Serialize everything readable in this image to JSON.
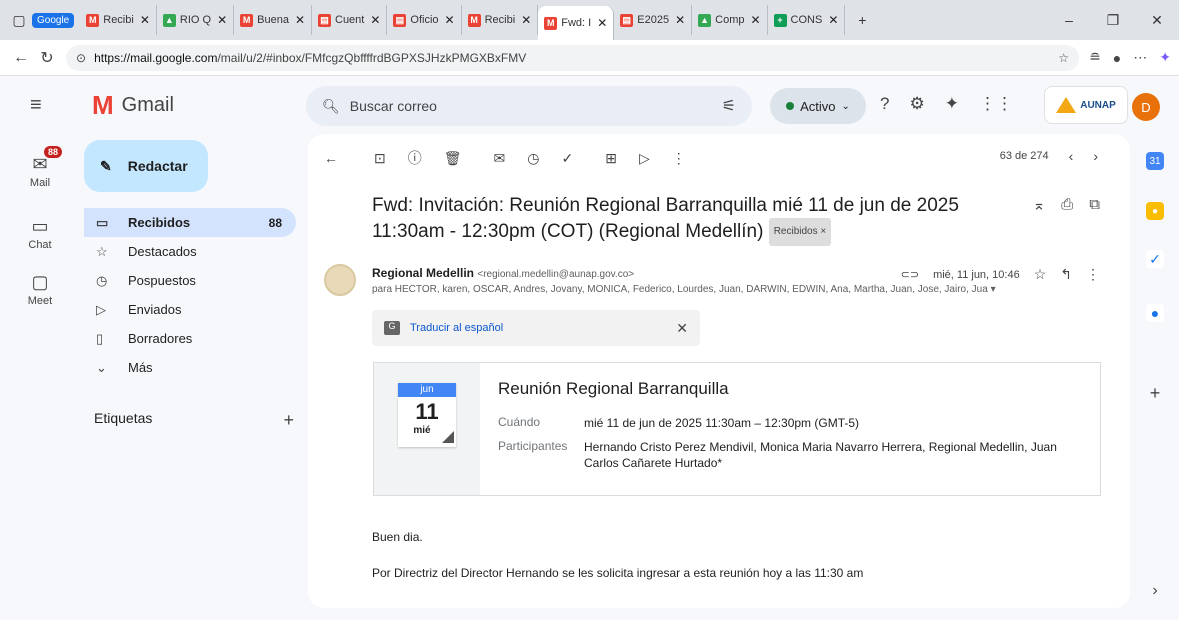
{
  "browser": {
    "google_chip": "Google",
    "tabs": [
      {
        "label": "Recibi",
        "fav": "M",
        "color": "#ea4335"
      },
      {
        "label": "RIO Q",
        "fav": "▲",
        "color": "#34a853"
      },
      {
        "label": "Buena",
        "fav": "M",
        "color": "#ea4335"
      },
      {
        "label": "Cuent",
        "fav": "▤",
        "color": "#ea4335"
      },
      {
        "label": "Oficio",
        "fav": "▤",
        "color": "#ea4335"
      },
      {
        "label": "Recibi",
        "fav": "M",
        "color": "#ea4335"
      },
      {
        "label": "Fwd: I",
        "fav": "M",
        "color": "#ea4335"
      },
      {
        "label": "E2025",
        "fav": "▤",
        "color": "#ea4335"
      },
      {
        "label": "Comp",
        "fav": "▲",
        "color": "#34a853"
      },
      {
        "label": "CONS",
        "fav": "+",
        "color": "#0f9d58"
      }
    ],
    "url_host": "https://mail.google.com",
    "url_path": "/mail/u/2/#inbox/FMfcgzQbffffrdBGPXSJHzkPMGXBxFMV"
  },
  "gmail": {
    "logo": "Gmail",
    "compose": "Redactar",
    "rail": {
      "mail": "Mail",
      "mail_badge": "88",
      "chat": "Chat",
      "meet": "Meet"
    },
    "nav": [
      {
        "label": "Recibidos",
        "count": "88",
        "icon": "▭"
      },
      {
        "label": "Destacados",
        "count": "",
        "icon": "☆"
      },
      {
        "label": "Pospuestos",
        "count": "",
        "icon": "◷"
      },
      {
        "label": "Enviados",
        "count": "",
        "icon": "▷"
      },
      {
        "label": "Borradores",
        "count": "",
        "icon": "▯"
      },
      {
        "label": "Más",
        "count": "",
        "icon": "⌄"
      }
    ],
    "labels_heading": "Etiquetas",
    "search_placeholder": "Buscar correo",
    "status": "Activo",
    "org": "AUNAP",
    "avatar": "D"
  },
  "message": {
    "pager": "63 de 274",
    "subject": "Fwd: Invitación: Reunión Regional Barranquilla mié 11 de jun de 2025 11:30am - 12:30pm (COT) (Regional Medellín)",
    "chip": "Recibidos ×",
    "sender_name": "Regional Medellin",
    "sender_email": "<regional.medellin@aunap.gov.co>",
    "date": "mié, 11 jun, 10:46",
    "to": "para HECTOR, karen, OSCAR, Andres, Jovany, MONICA, Federico, Lourdes, Juan, DARWIN, EDWIN, Ana, Martha, Juan, Jose, Jairo, Jua ▾",
    "translate": "Traducir al español",
    "invite": {
      "month": "jun",
      "day": "11",
      "weekday": "mié",
      "title": "Reunión Regional Barranquilla",
      "when_label": "Cuándo",
      "when_value": "mié 11 de jun de 2025 11:30am – 12:30pm (GMT-5)",
      "who_label": "Participantes",
      "who_value": "Hernando Cristo Perez Mendivil, Monica Maria Navarro Herrera, Regional Medellin, Juan Carlos Cañarete Hurtado*"
    },
    "body": [
      "Buen dia.",
      "Por Directriz del Director Hernando se les solicita ingresar a esta reunión hoy a las 11:30 am"
    ]
  }
}
